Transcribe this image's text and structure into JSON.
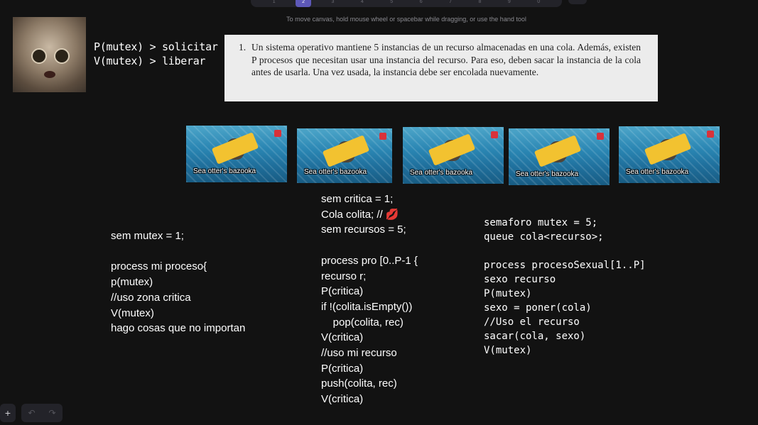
{
  "toolbar": {
    "tools": [
      "1",
      "2",
      "3",
      "4",
      "5",
      "6",
      "7",
      "8",
      "9",
      "0"
    ],
    "active_index": 1
  },
  "hint": "To move canvas, hold mouse wheel or spacebar while dragging, or use the hand tool",
  "notes": {
    "line1": "P(mutex) > solicitar",
    "line2": "V(mutex) > liberar"
  },
  "problem": {
    "number": "1.",
    "text": "Un sistema operativo mantiene 5 instancias de un recurso almacenadas en una cola. Además, existen P procesos que necesitan usar una instancia del recurso. Para eso, deben sacar la instancia de la cola antes de usarla. Una vez usada, la instancia debe ser encolada nuevamente."
  },
  "thumbnails": [
    {
      "caption": "Sea otter's bazooka"
    },
    {
      "caption": "Sea otter's bazooka"
    },
    {
      "caption": "Sea otter's bazooka"
    },
    {
      "caption": "Sea otter's bazooka"
    },
    {
      "caption": "Sea otter's bazooka"
    }
  ],
  "code_left": [
    "sem mutex = 1;",
    "",
    "process mi proceso{",
    "p(mutex)",
    "//uso zona critica",
    "V(mutex)",
    "hago cosas que no importan"
  ],
  "code_middle": [
    "sem critica = 1;",
    "Cola colita; // 💋",
    "sem recursos = 5;",
    "",
    "process pro [0..P-1 {",
    "recurso r;",
    "P(critica)",
    "if !(colita.isEmpty())",
    "    pop(colita, rec)",
    "V(critica)",
    "//uso mi recurso",
    "P(critica)",
    "push(colita, rec)",
    "V(critica)"
  ],
  "code_right": [
    "semaforo mutex = 5;",
    "queue cola<recurso>;",
    "",
    "process procesoSexual[1..P]",
    "sexo recurso",
    "P(mutex)",
    "sexo = poner(cola)",
    "//Uso el recurso",
    "sacar(cola, sexo)",
    "V(mutex)"
  ],
  "bottom": {
    "add": "+",
    "undo": "↶",
    "redo": "↷"
  }
}
